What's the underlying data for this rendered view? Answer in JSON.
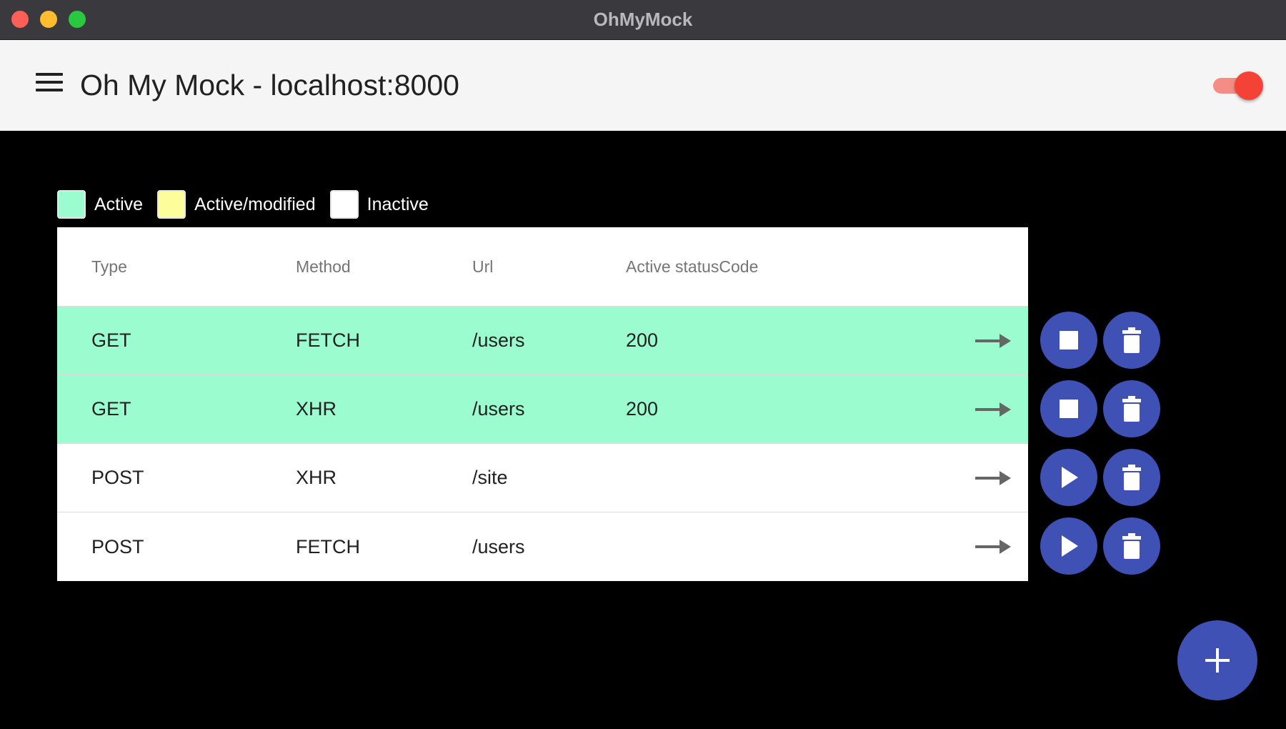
{
  "window": {
    "title": "OhMyMock"
  },
  "toolbar": {
    "title": "Oh My Mock - localhost:8000",
    "enabled": true
  },
  "legend": [
    {
      "label": "Active",
      "color": "#9bfcd0"
    },
    {
      "label": "Active/modified",
      "color": "#fdfd9c"
    },
    {
      "label": "Inactive",
      "color": "#ffffff"
    }
  ],
  "table": {
    "headers": [
      "Type",
      "Method",
      "Url",
      "Active statusCode"
    ],
    "rows": [
      {
        "type": "GET",
        "method": "FETCH",
        "url": "/users",
        "status": "200",
        "state": "active",
        "action_icon": "stop-icon"
      },
      {
        "type": "GET",
        "method": "XHR",
        "url": "/users",
        "status": "200",
        "state": "active",
        "action_icon": "stop-icon"
      },
      {
        "type": "POST",
        "method": "XHR",
        "url": "/site",
        "status": "",
        "state": "inactive",
        "action_icon": "play-icon"
      },
      {
        "type": "POST",
        "method": "FETCH",
        "url": "/users",
        "status": "",
        "state": "inactive",
        "action_icon": "play-icon"
      }
    ]
  },
  "colors": {
    "primary": "#3f51b5",
    "accent": "#f44336",
    "active_row": "#9bfcd0"
  },
  "icons": {
    "row_open": "arrow-right-icon",
    "delete": "trash-icon",
    "add": "plus-icon",
    "menu": "hamburger-menu-icon"
  }
}
